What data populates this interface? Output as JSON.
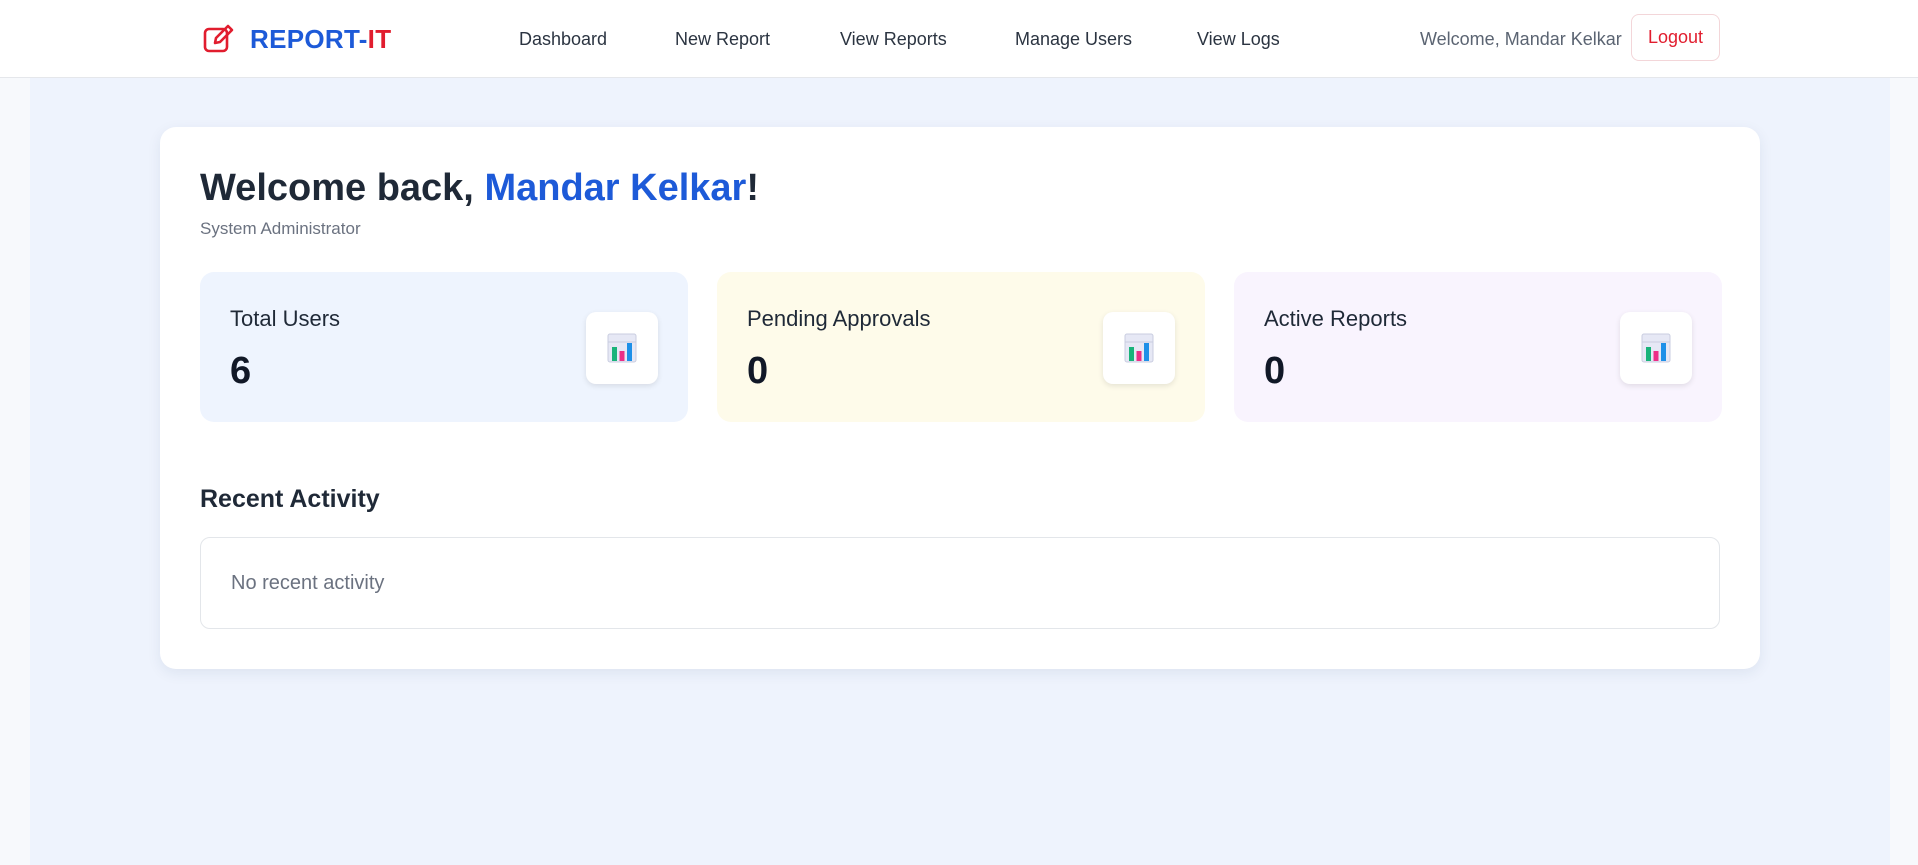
{
  "brand": {
    "part1": "REPORT-",
    "part2": "IT",
    "icon": "edit-note-icon"
  },
  "nav": {
    "items": [
      {
        "label": "Dashboard"
      },
      {
        "label": "New Report"
      },
      {
        "label": "View Reports"
      },
      {
        "label": "Manage Users"
      },
      {
        "label": "View Logs"
      }
    ]
  },
  "user": {
    "welcome": "Welcome, Mandar Kelkar",
    "logout_label": "Logout"
  },
  "main": {
    "greeting_prefix": "Welcome back, ",
    "user_name": "Mandar Kelkar",
    "greeting_suffix": "!",
    "role": "System Administrator",
    "stats": [
      {
        "label": "Total Users",
        "value": "6",
        "icon": "bar-chart-icon"
      },
      {
        "label": "Pending Approvals",
        "value": "0",
        "icon": "bar-chart-icon"
      },
      {
        "label": "Active Reports",
        "value": "0",
        "icon": "bar-chart-icon"
      }
    ],
    "recent_activity": {
      "title": "Recent Activity",
      "empty_text": "No recent activity"
    }
  },
  "colors": {
    "brand_blue": "#1d5ad8",
    "brand_red": "#e11d2e",
    "page_bg": "#eef3fd",
    "stat_blue_bg": "#eef4fe",
    "stat_yellow_bg": "#fefbea",
    "stat_purple_bg": "#f9f4fe"
  }
}
